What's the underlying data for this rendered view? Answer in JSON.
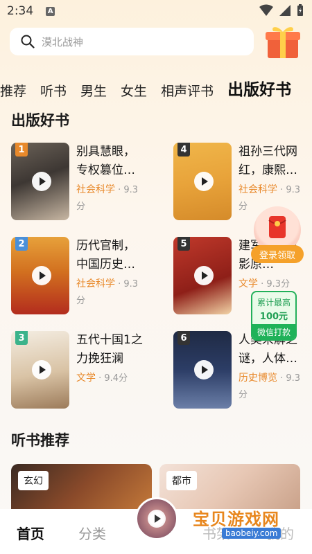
{
  "status_bar": {
    "time": "2:34",
    "badge": "A"
  },
  "search": {
    "placeholder": "漠北战神"
  },
  "tabs": [
    {
      "label": "推荐"
    },
    {
      "label": "听书"
    },
    {
      "label": "男生"
    },
    {
      "label": "女生"
    },
    {
      "label": "相声评书"
    },
    {
      "label": "出版好书"
    }
  ],
  "section_published": {
    "title": "出版好书"
  },
  "books": [
    {
      "rank": "1",
      "title": "别具慧眼，专权篡位…",
      "category": "社会科学",
      "score": " · 9.3分"
    },
    {
      "rank": "4",
      "title": "祖孙三代网红，康熙…",
      "category": "社会科学",
      "score": " · 9.3分"
    },
    {
      "rank": "2",
      "title": "历代官制，中国历史…",
      "category": "社会科学",
      "score": " · 9.3分"
    },
    {
      "rank": "5",
      "title": "建军…（电影原…",
      "category": "文学",
      "score": " · 9.3分"
    },
    {
      "rank": "3",
      "title": "五代十国1之力挽狂澜",
      "category": "文学",
      "score": " · 9.4分"
    },
    {
      "rank": "6",
      "title": "人类未解之谜，人体…",
      "category": "历史博览",
      "score": " · 9.3分"
    }
  ],
  "section_audio": {
    "title": "听书推荐"
  },
  "audio_cards": [
    {
      "tag": "玄幻"
    },
    {
      "tag": "都市"
    }
  ],
  "float_login": {
    "label": "登录领取"
  },
  "float_wechat": {
    "line1": "累计最高",
    "line2": "100元",
    "line3": "微信打款"
  },
  "bottom_nav": [
    {
      "label": "首页"
    },
    {
      "label": "分类"
    },
    {
      "label": "书架"
    },
    {
      "label": "我的"
    }
  ],
  "watermark": {
    "text": "宝贝游戏网",
    "url": "baobeiy.com"
  },
  "colors": {
    "accent": "#e8892b",
    "rank1": "#e8892b",
    "rank2": "#4a90d9",
    "rank3": "#3bb38b",
    "rank_other": "#333333",
    "wechat": "#1fb259"
  }
}
